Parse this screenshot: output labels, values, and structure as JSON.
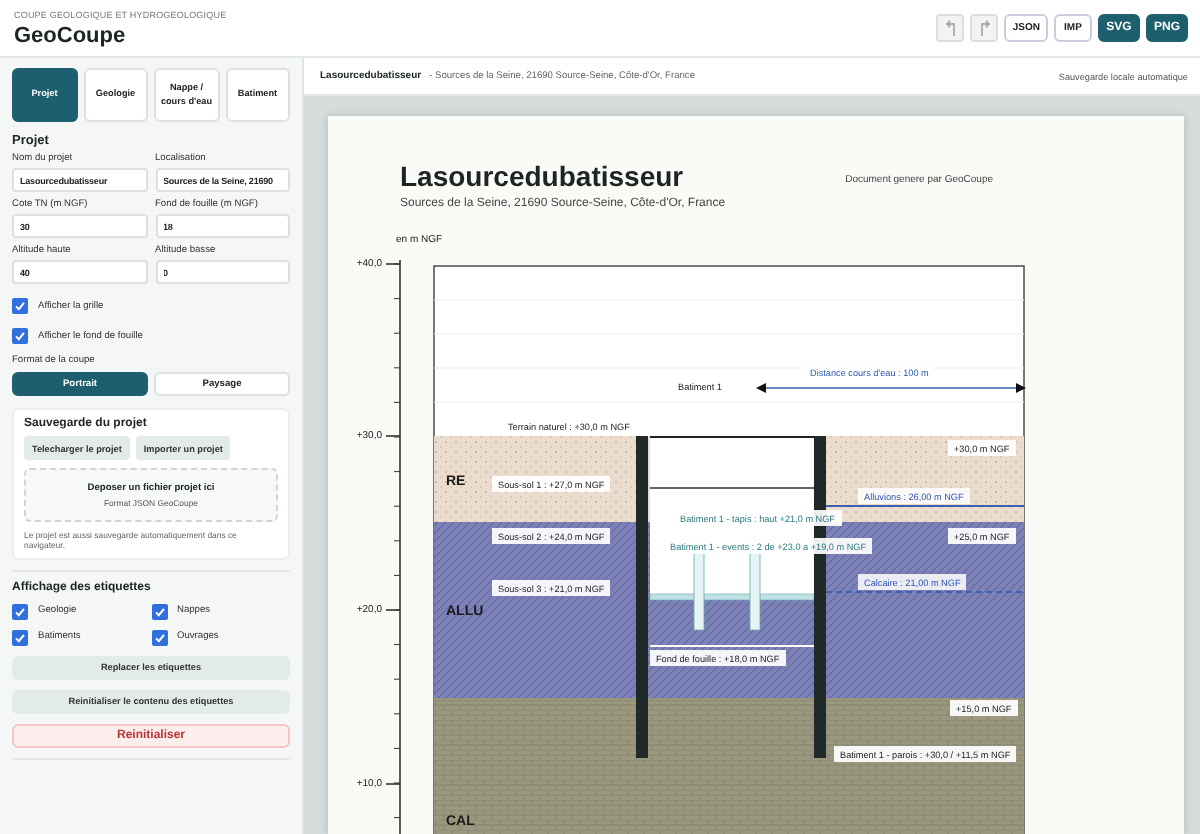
{
  "header": {
    "subtitle": "COUPE GEOLOGIQUE ET HYDROGEOLOGIQUE",
    "title": "GeoCoupe",
    "history_buttons": [
      {
        "kind": "undo",
        "disabled": true
      },
      {
        "kind": "redo",
        "disabled": true
      }
    ],
    "export_buttons": [
      {
        "label": "JSON",
        "primary": false
      },
      {
        "label": "IMP",
        "primary": false
      },
      {
        "label": "SVG",
        "primary": true
      },
      {
        "label": "PNG",
        "primary": true
      }
    ]
  },
  "sidebar": {
    "tabs": [
      {
        "label": "Projet",
        "selected": true
      },
      {
        "label": "Geologie",
        "selected": false
      },
      {
        "label": "Nappe / cours d'eau",
        "selected": false
      },
      {
        "label": "Batiment",
        "selected": false
      }
    ],
    "project": {
      "title": "Projet",
      "fields": [
        {
          "label": "Nom du projet",
          "value": "Lasourcedubatisseur"
        },
        {
          "label": "Localisation",
          "value": "Sources de la Seine, 21690"
        },
        {
          "label": "Cote TN (m NGF)",
          "value": "30"
        },
        {
          "label": "Fond de fouille (m NGF)",
          "value": "18"
        },
        {
          "label": "Altitude haute",
          "value": "40"
        },
        {
          "label": "Altitude basse",
          "value": "0"
        }
      ],
      "checkboxes": [
        {
          "label": "Afficher la grille",
          "checked": true
        },
        {
          "label": "Afficher le fond de fouille",
          "checked": true
        }
      ],
      "format": {
        "label": "Format de la coupe",
        "options": [
          {
            "label": "Portrait",
            "selected": true
          },
          {
            "label": "Paysage",
            "selected": false
          }
        ]
      }
    },
    "save": {
      "title": "Sauvegarde du projet",
      "buttons": [
        "Telecharger le projet",
        "Importer un projet"
      ],
      "dropzone": {
        "title": "Deposer un fichier projet ici",
        "subtitle": "Format JSON GeoCoupe"
      },
      "note": "Le projet est aussi sauvegarde automatiquement dans ce navigateur."
    },
    "labels": {
      "title": "Affichage des etiquettes",
      "checkboxes": [
        {
          "label": "Geologie",
          "checked": true
        },
        {
          "label": "Nappes",
          "checked": true
        },
        {
          "label": "Batiments",
          "checked": true
        },
        {
          "label": "Ouvrages",
          "checked": true
        }
      ],
      "buttons": [
        "Replacer les etiquettes",
        "Reinitialiser le contenu des etiquettes"
      ],
      "reset_button": "Reinitialiser"
    }
  },
  "main": {
    "top_bar": {
      "title": "Lasourcedubatisseur",
      "location": "- Sources de la Seine, 21690 Source-Seine, Côte-d'Or, France",
      "status": "Sauvegarde locale automatique"
    },
    "document": {
      "title": "Lasourcedubatisseur",
      "subtitle": "Sources de la Seine, 21690 Source-Seine, Côte-d'Or, France",
      "generator": "Document genere par GeoCoupe",
      "section": {
        "unit": "en m NGF",
        "ticks": [
          "+40,0",
          "+30,0",
          "+20,0",
          "+10,0"
        ],
        "layers": [
          {
            "code": "RE",
            "color": "#ecdccd"
          },
          {
            "code": "ALLU",
            "color": "#7d82b8"
          },
          {
            "code": "CAL",
            "color": "#9b9880"
          }
        ],
        "annotations": [
          {
            "text": "Batiment 1",
            "kind": "plain"
          },
          {
            "text": "Distance cours d'eau : 100 m",
            "kind": "water"
          },
          {
            "text": "Terrain naturel : +30,0 m NGF",
            "kind": "plain"
          },
          {
            "text": "+30,0 m NGF",
            "kind": "plain"
          },
          {
            "text": "Sous-sol 1 : +27,0 m NGF",
            "kind": "plain"
          },
          {
            "text": "Alluvions : 26,00 m NGF",
            "kind": "water"
          },
          {
            "text": "Batiment 1 - tapis : haut +21,0 m NGF",
            "kind": "structure"
          },
          {
            "text": "Sous-sol 2 : +24,0 m NGF",
            "kind": "plain"
          },
          {
            "text": "+25,0 m NGF",
            "kind": "plain"
          },
          {
            "text": "Batiment 1 - events : 2 de +23,0 a +19,0 m NGF",
            "kind": "structure"
          },
          {
            "text": "Sous-sol 3 : +21,0 m NGF",
            "kind": "plain"
          },
          {
            "text": "Calcaire : 21,00 m NGF",
            "kind": "water"
          },
          {
            "text": "Fond de fouille : +18,0 m NGF",
            "kind": "plain"
          },
          {
            "text": "+15,0 m NGF",
            "kind": "plain"
          },
          {
            "text": "Batiment 1 - parois : +30,0 / +11,5 m NGF",
            "kind": "plain"
          }
        ]
      }
    }
  }
}
